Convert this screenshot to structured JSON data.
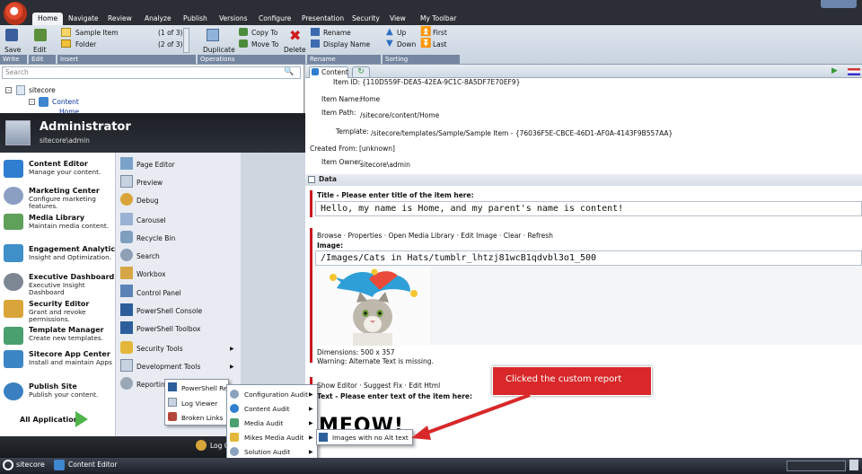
{
  "ribbon_tabs": [
    "Home",
    "Navigate",
    "Review",
    "Analyze",
    "Publish",
    "Versions",
    "Configure",
    "Presentation",
    "Security",
    "View",
    "My Toolbar"
  ],
  "ribbon": {
    "save": "Save",
    "edit": "Edit",
    "sample_item": "Sample Item",
    "sample_count": "(1 of 3)",
    "folder": "Folder",
    "folder_count": "(2 of 3)",
    "duplicate": "Duplicate",
    "copy_to": "Copy To",
    "move_to": "Move To",
    "delete": "Delete",
    "rename": "Rename",
    "display_name": "Display Name",
    "up": "Up",
    "down": "Down",
    "first": "First",
    "last": "Last",
    "groups": [
      "Write",
      "Edit",
      "Insert",
      "Operations",
      "Rename",
      "Sorting"
    ]
  },
  "search_placeholder": "Search",
  "tree": [
    "sitecore",
    "Content",
    "Home"
  ],
  "start_menu": {
    "user_title": "Administrator",
    "user_sub": "sitecore\\admin",
    "left_items": [
      {
        "title": "Content Editor",
        "sub": "Manage your content."
      },
      {
        "title": "Marketing Center",
        "sub": "Configure marketing features."
      },
      {
        "title": "Media Library",
        "sub": "Maintain media content."
      },
      {
        "title": "Engagement Analytics",
        "sub": "Insight and Optimization."
      },
      {
        "title": "Executive Dashboard",
        "sub": "Executive Insight Dashboard"
      },
      {
        "title": "Security Editor",
        "sub": "Grant and revoke permissions."
      },
      {
        "title": "Template Manager",
        "sub": "Create new templates."
      },
      {
        "title": "Sitecore App Center",
        "sub": "Install and maintain Apps"
      },
      {
        "title": "Publish Site",
        "sub": "Publish your content."
      }
    ],
    "all_apps": "All Applications",
    "right_items": [
      "Page Editor",
      "Preview",
      "Debug",
      "Carousel",
      "Recycle Bin",
      "Search",
      "Workbox",
      "Control Panel",
      "PowerShell Console",
      "PowerShell Toolbox",
      "Security Tools",
      "Development Tools",
      "Reporting"
    ],
    "logoff": "Log O"
  },
  "submenu1": [
    "PowerShell Re",
    "Log Viewer",
    "Broken Links"
  ],
  "submenu2": [
    "Configuration Audit",
    "Content Audit",
    "Media Audit",
    "Mikes Media Audit",
    "Solution Audit"
  ],
  "submenu3": [
    "Images with no Alt text"
  ],
  "content": {
    "tab": "Content",
    "item_id_label": "Item ID:",
    "item_id": "{110D559F-DEA5-42EA-9C1C-8A5DF7E70EF9}",
    "item_name_label": "Item Name:",
    "item_name": "Home",
    "item_path_label": "Item Path:",
    "item_path": "/sitecore/content/Home",
    "template_label": "Template:",
    "template": "/sitecore/templates/Sample/Sample Item - {76036F5E-CBCE-46D1-AF0A-4143F9B557AA}",
    "created_from_label": "Created From:",
    "created_from": "[unknown]",
    "owner_label": "Item Owner:",
    "owner": "sitecore\\admin",
    "data_section": "Data",
    "title_label": "Title - Please enter title of the item here:",
    "title_value": "Hello, my name is Home, and my parent's name is content!",
    "image_links": "Browse · Properties · Open Media Library · Edit Image · Clear · Refresh",
    "image_label": "Image:",
    "image_value": "/Images/Cats in Hats/tumblr_lhtzj81wcB1qdvbl3o1_500",
    "dimensions": "Dimensions: 500 x 357",
    "warning": "Warning: Alternate Text is missing.",
    "text_links": "Show Editor · Suggest Fix · Edit Html",
    "text_label": "Text - Please enter text of the item here:",
    "text_value": "MEOW!"
  },
  "callout": "Clicked the custom report",
  "taskbar": {
    "start": "sitecore",
    "app": "Content Editor"
  }
}
